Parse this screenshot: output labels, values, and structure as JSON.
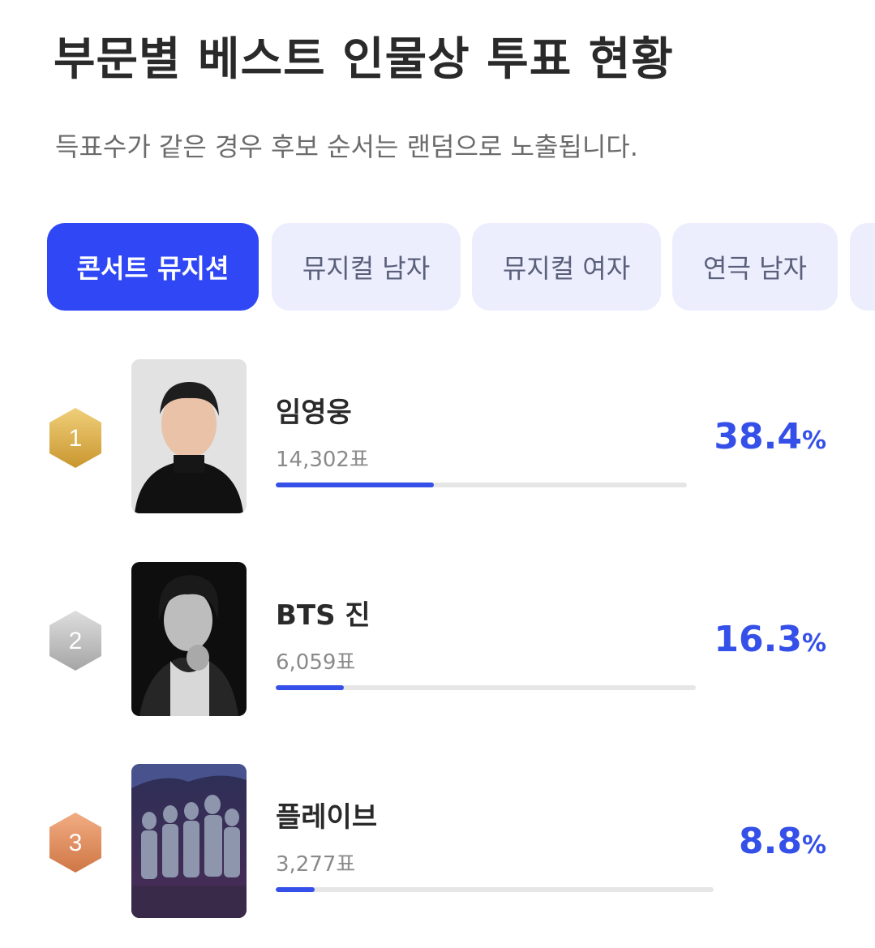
{
  "page": {
    "title": "부문별 베스트 인물상 투표 현황",
    "subtitle": "득표수가 같은 경우 후보 순서는 랜덤으로 노출됩니다."
  },
  "tabs": [
    {
      "label": "콘서트 뮤지션",
      "active": true
    },
    {
      "label": "뮤지컬 남자",
      "active": false
    },
    {
      "label": "뮤지컬 여자",
      "active": false
    },
    {
      "label": "연극 남자",
      "active": false
    }
  ],
  "ranking": [
    {
      "rank": "1",
      "name": "임영웅",
      "votes": "14,302표",
      "percent": "38.4",
      "unit": "%",
      "share": 0.384,
      "medal": "gold"
    },
    {
      "rank": "2",
      "name": "BTS 진",
      "votes": "6,059표",
      "percent": "16.3",
      "unit": "%",
      "share": 0.163,
      "medal": "silver"
    },
    {
      "rank": "3",
      "name": "플레이브",
      "votes": "3,277표",
      "percent": "8.8",
      "unit": "%",
      "share": 0.088,
      "medal": "bronze"
    }
  ],
  "colors": {
    "accent": "#3550e8",
    "active_tab": "#2f47f5",
    "inactive_tab": "#eceefe",
    "gold": "#d9a94a",
    "silver": "#b8b8b8",
    "bronze": "#de8a5a"
  }
}
